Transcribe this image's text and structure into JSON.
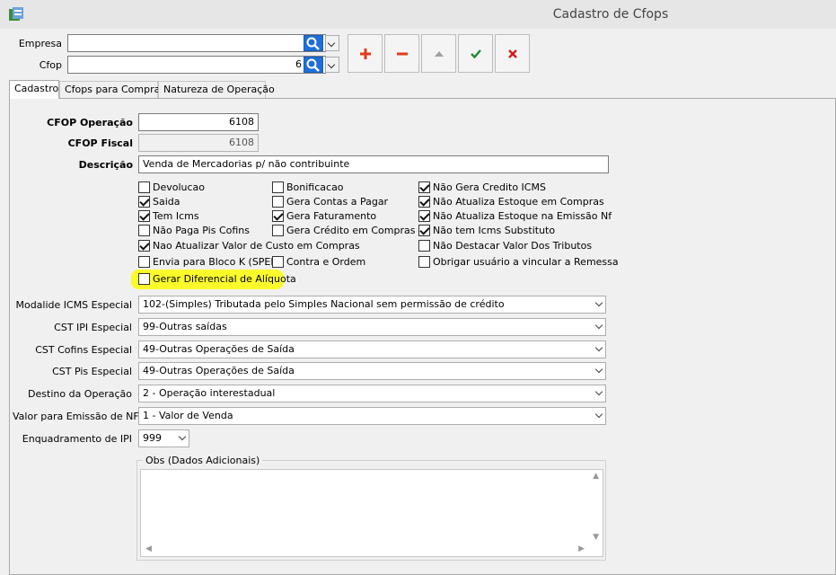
{
  "window": {
    "title": "Cadastro de Cfops"
  },
  "filters": {
    "empresa_label": "Empresa",
    "empresa_value": "",
    "cfop_label": "Cfop",
    "cfop_value": "6"
  },
  "toolbar": {
    "buttons": [
      {
        "name": "add",
        "icon": "plus-icon",
        "color": "#e23b1b"
      },
      {
        "name": "remove",
        "icon": "minus-icon",
        "color": "#e23b1b"
      },
      {
        "name": "up",
        "icon": "triangle-up-icon",
        "color": "#a0a0a0"
      },
      {
        "name": "confirm",
        "icon": "check-icon",
        "color": "#1a8a2e"
      },
      {
        "name": "cancel",
        "icon": "x-icon",
        "color": "#d41a1a"
      }
    ]
  },
  "tabs": [
    {
      "label": "Cadastro",
      "active": true
    },
    {
      "label": "Cfops para Compras",
      "active": false
    },
    {
      "label": "Natureza de Operação",
      "active": false
    }
  ],
  "form": {
    "cfop_operacao_label": "CFOP Operação",
    "cfop_operacao_value": "6108",
    "cfop_fiscal_label": "CFOP Fiscal",
    "cfop_fiscal_value": "6108",
    "descricao_label": "Descrição",
    "descricao_value": "Venda de Mercadorias p/ não contribuinte"
  },
  "checkboxes": {
    "col1": [
      {
        "label": "Devolucao",
        "checked": false
      },
      {
        "label": "Saida",
        "checked": true
      },
      {
        "label": "Tem Icms",
        "checked": true
      },
      {
        "label": "Não Paga Pis Cofins",
        "checked": false
      },
      {
        "label": "Nao Atualizar Valor de Custo em Compras",
        "checked": true
      },
      {
        "label": "Envia para Bloco K (SPED)",
        "checked": false
      },
      {
        "label": "Gerar Diferencial de Alíquota",
        "checked": false
      }
    ],
    "col2": [
      {
        "label": "Bonificacao",
        "checked": false
      },
      {
        "label": "Gera Contas a Pagar",
        "checked": false
      },
      {
        "label": "Gera Faturamento",
        "checked": true
      },
      {
        "label": "Gera Crédito em Compras",
        "checked": false
      },
      {
        "label": "Contra e Ordem",
        "checked": false
      }
    ],
    "col3": [
      {
        "label": "Não Gera Credito ICMS",
        "checked": true
      },
      {
        "label": "Não Atualiza Estoque em Compras",
        "checked": true
      },
      {
        "label": "Não Atualiza Estoque na Emissão Nf",
        "checked": true
      },
      {
        "label": "Não tem Icms Substituto",
        "checked": true
      },
      {
        "label": "Não Destacar Valor Dos Tributos",
        "checked": false
      },
      {
        "label": "Obrigar usuário a vincular a Remessa",
        "checked": false
      }
    ],
    "highlight_color": "#fbfb2c"
  },
  "selects": [
    {
      "label": "Modalide ICMS Especial",
      "value": "102-(Simples) Tributada pelo Simples Nacional sem permissão de crédito"
    },
    {
      "label": "CST IPI Especial",
      "value": "99-Outras saídas"
    },
    {
      "label": "CST Cofins Especial",
      "value": "49-Outras Operações de Saída"
    },
    {
      "label": "CST Pis Especial",
      "value": "49-Outras Operações de Saída"
    },
    {
      "label": "Destino da Operação",
      "value": "2 - Operação interestadual"
    },
    {
      "label": "Valor para Emissão de NF",
      "value": "1 - Valor de Venda"
    }
  ],
  "enquadramento": {
    "label": "Enquadramento de IPI",
    "value": "999"
  },
  "obs": {
    "legend": "Obs (Dados Adicionais)",
    "value": ""
  }
}
